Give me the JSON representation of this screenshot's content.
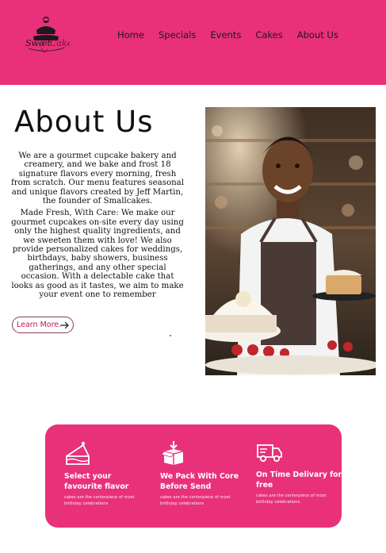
{
  "brand": {
    "logo_text": "SweetCake",
    "accent_color": "#e8317a"
  },
  "nav": {
    "items": [
      {
        "label": "Home"
      },
      {
        "label": "Specials"
      },
      {
        "label": "Events"
      },
      {
        "label": "Cakes"
      },
      {
        "label": "About Us"
      }
    ]
  },
  "main": {
    "title": "About Us",
    "paragraph_1": "We are a gourmet cupcake bakery and creamery, and we bake and frost 18 signature flavors every morning, fresh from scratch. Our menu features seasonal and unique flavors created by Jeff Martin, the founder of Smallcakes.",
    "paragraph_2": "Made Fresh, With Care: We make our gourmet cupcakes on-site every day using only the highest quality ingredients, and we sweeten them with love! We also provide personalized cakes for weddings, birthdays, baby showers, business gatherings, and any other special occasion. With a delectable cake that looks as good as it tastes, we aim to make your event one to remember",
    "cta_label": "Learn More."
  },
  "features": [
    {
      "icon": "cake-slice-icon",
      "title": "Select your favourite flavor",
      "description": "cakes are the centerpiece of most birthday celebrations"
    },
    {
      "icon": "package-icon",
      "title": "We Pack With Core Before Send",
      "description": "cakes are the centerpiece of most birthday celebrations"
    },
    {
      "icon": "delivery-truck-icon",
      "title": "On Time Delivary for free",
      "description": "cakes are the centerpiece of most birthday celebrations"
    }
  ]
}
